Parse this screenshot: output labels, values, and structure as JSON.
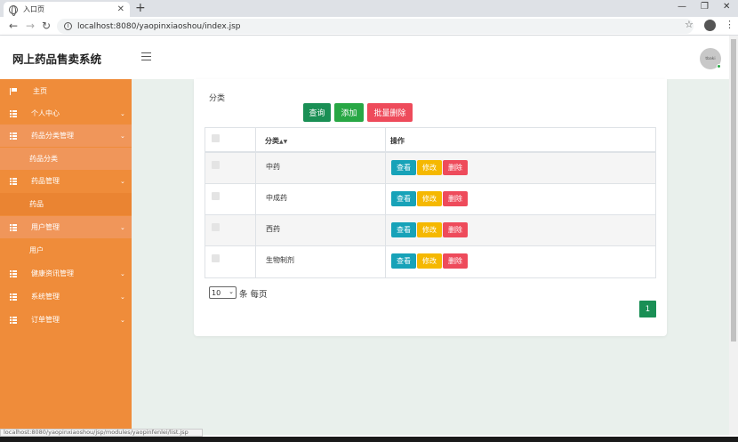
{
  "browser": {
    "tab_title": "入口页",
    "url": "localhost:8080/yaopinxiaoshou/index.jsp",
    "status_url": "localhost:8080/yaopinxiaoshou/jsp/modules/yaopinfenlei/list.jsp"
  },
  "header": {
    "title": "网上药品售卖系统",
    "avatar_text": "tbaki"
  },
  "sidebar": {
    "items": [
      {
        "label": "主页",
        "icon": "flag-icon"
      },
      {
        "label": "个人中心",
        "icon": "grid-icon"
      },
      {
        "label": "药品分类管理",
        "icon": "grid-icon"
      },
      {
        "label": "药品分类",
        "sub": true
      },
      {
        "label": "药品管理",
        "icon": "grid-icon"
      },
      {
        "label": "药品",
        "sub": true
      },
      {
        "label": "用户管理",
        "icon": "grid-icon"
      },
      {
        "label": "用户",
        "sub": true
      },
      {
        "label": "健康资讯管理",
        "icon": "grid-icon"
      },
      {
        "label": "系统管理",
        "icon": "grid-icon"
      },
      {
        "label": "订单管理",
        "icon": "grid-icon"
      }
    ]
  },
  "search": {
    "label": "分类",
    "value": "",
    "query_label": "查询",
    "add_label": "添加",
    "batch_delete_label": "批量删除"
  },
  "table": {
    "col_category": "分类",
    "col_actions": "操作",
    "rows": [
      {
        "category": "中药"
      },
      {
        "category": "中成药"
      },
      {
        "category": "西药"
      },
      {
        "category": "生物制剂"
      }
    ],
    "view_label": "查看",
    "edit_label": "修改",
    "delete_label": "删除"
  },
  "pagination": {
    "page_size": "10",
    "per_page_label": "条 每页",
    "current_page": "1"
  },
  "colors": {
    "sidebar": "#ef8c3a",
    "primary_green": "#1a8f55",
    "view": "#17a2b8",
    "edit": "#f5b800",
    "delete": "#ee4b5b"
  }
}
